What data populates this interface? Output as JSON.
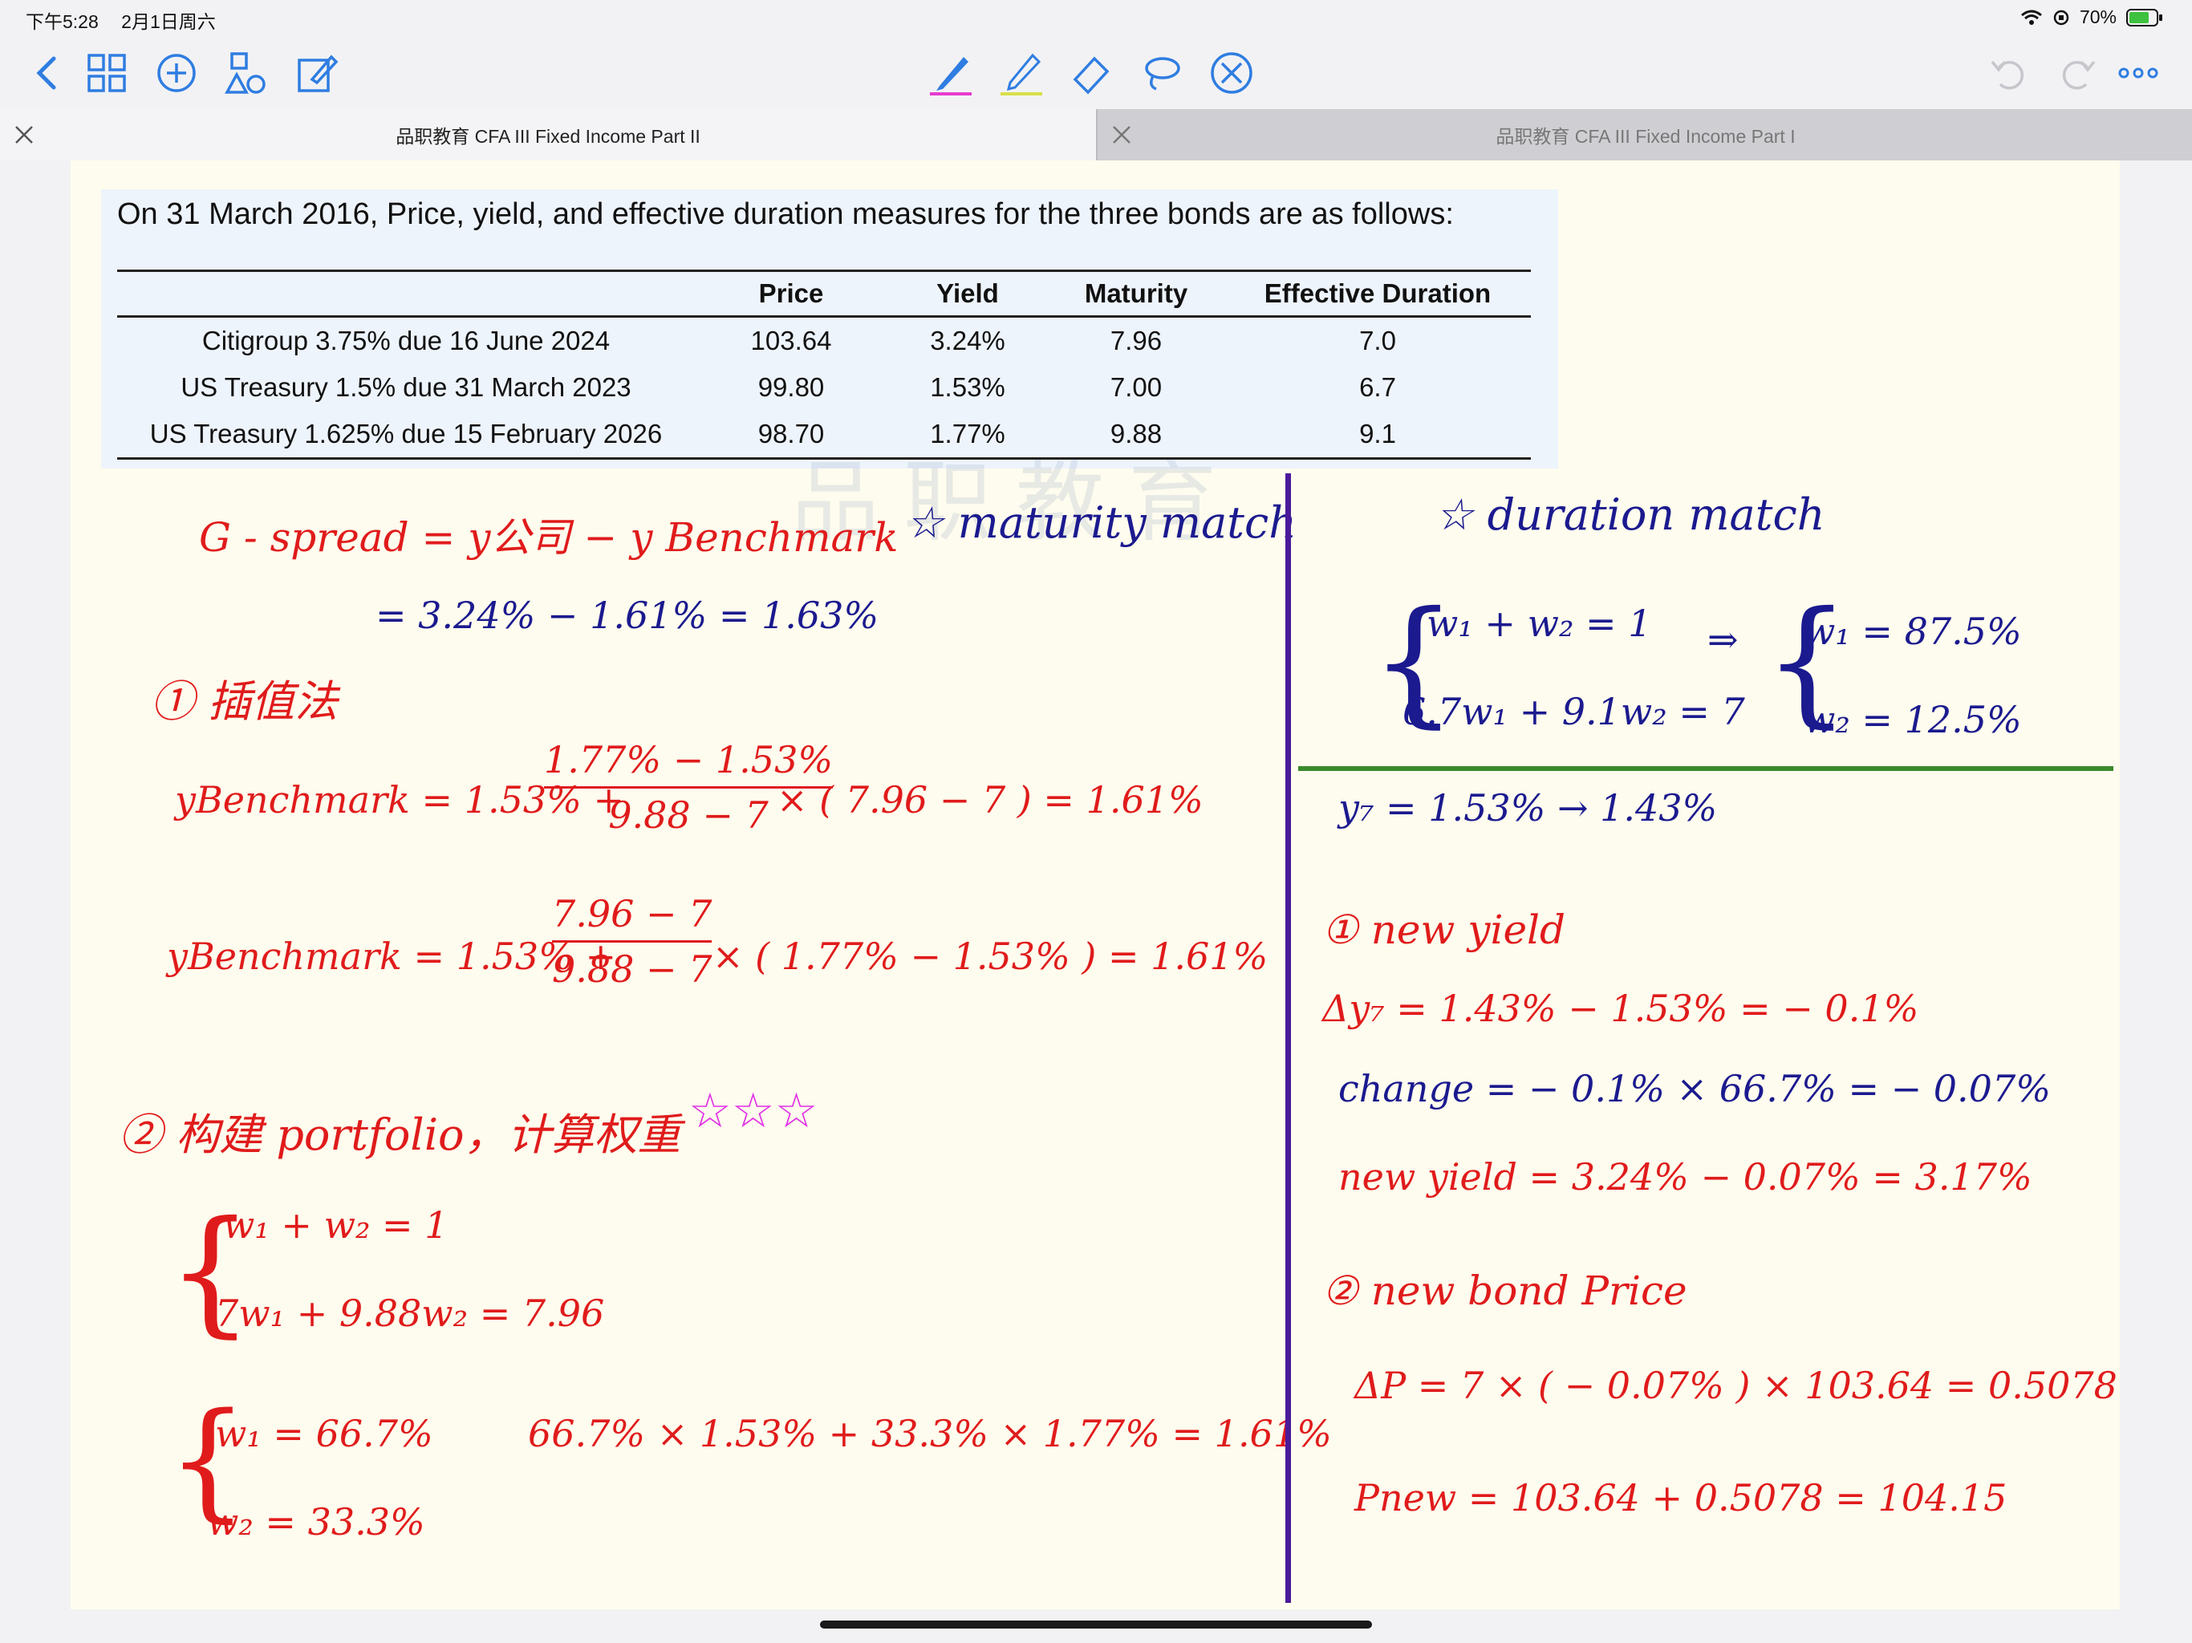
{
  "status_bar": {
    "time": "下午5:28",
    "date": "2月1日周六",
    "battery": "70%"
  },
  "toolbar": {
    "left_icons": [
      "back-icon",
      "grid-icon",
      "add-icon",
      "shapes-icon",
      "edit-icon"
    ],
    "tools": [
      "pen-icon",
      "highlighter-icon",
      "eraser-icon",
      "lasso-icon",
      "close-circle-icon"
    ],
    "pen_color": "#e63ccf",
    "highlighter_color": "#d7e04a",
    "right_icons": [
      "undo-icon",
      "redo-icon",
      "more-icon"
    ]
  },
  "tabs": [
    {
      "label": "品职教育 CFA III Fixed Income Part II",
      "active": true
    },
    {
      "label": "品职教育 CFA III Fixed Income Part I",
      "active": false
    }
  ],
  "document": {
    "caption": "On 31 March 2016, Price, yield, and effective duration measures for the three bonds are as follows:",
    "headers": [
      "",
      "Price",
      "Yield",
      "Maturity",
      "Effective Duration"
    ],
    "rows": [
      [
        "Citigroup 3.75% due 16 June 2024",
        "103.64",
        "3.24%",
        "7.96",
        "7.0"
      ],
      [
        "US Treasury 1.5% due 31 March 2023",
        "99.80",
        "1.53%",
        "7.00",
        "6.7"
      ],
      [
        "US Treasury 1.625% due 15 February 2026",
        "98.70",
        "1.77%",
        "9.88",
        "9.1"
      ]
    ],
    "watermark": "品职教育"
  },
  "notes_left": {
    "g_spread": "G - spread = y公司 − y Benchmark",
    "g_spread_calc": "= 3.24% − 1.61% = 1.63%",
    "method1": "① 插值法",
    "yb1_lhs": "yBenchmark = 1.53% +",
    "yb1_num": "1.77% − 1.53%",
    "yb1_den": "9.88 − 7",
    "yb1_rhs": "× ( 7.96 − 7 ) = 1.61%",
    "yb2_lhs": "yBenchmark = 1.53% +",
    "yb2_num": "7.96 − 7",
    "yb2_den": "9.88 − 7",
    "yb2_rhs": "× ( 1.77% − 1.53% ) = 1.61%",
    "method2": "② 构建 portfolio，计算权重",
    "stars": "☆☆☆",
    "eq1": "w₁ + w₂ = 1",
    "eq2": "7w₁ + 9.88w₂ = 7.96",
    "w1": "w₁ = 66.7%",
    "w2": "w₂ = 33.3%",
    "check": "66.7% × 1.53% + 33.3% × 1.77% = 1.61%"
  },
  "notes_middle": {
    "maturity_match": "☆ maturity match"
  },
  "notes_right": {
    "duration_match": "☆ duration match",
    "eq1": "w₁ + w₂ = 1",
    "eq2": "6.7w₁ + 9.1w₂ = 7",
    "arrow": "⇒",
    "w1": "w₁ = 87.5%",
    "w2": "w₂ = 12.5%",
    "y7": "y₇ = 1.53% → 1.43%",
    "new_yield": "① new yield",
    "dy": "Δy₇ = 1.43% − 1.53% = − 0.1%",
    "change": "change = − 0.1% × 66.7% = − 0.07%",
    "new_yield_calc": "new yield = 3.24% − 0.07% = 3.17%",
    "new_bond_price": "② new bond Price",
    "dp": "ΔP = 7 × ( − 0.07% ) × 103.64 = 0.5078",
    "pnew": "Pnew = 103.64 + 0.5078 = 104.15"
  },
  "colors": {
    "ink_red": "#e01b1b",
    "ink_blue": "#1b1a8f",
    "divider_purple": "#4a1a9a",
    "divider_green": "#3a8a2a",
    "paper": "#fefcee"
  }
}
